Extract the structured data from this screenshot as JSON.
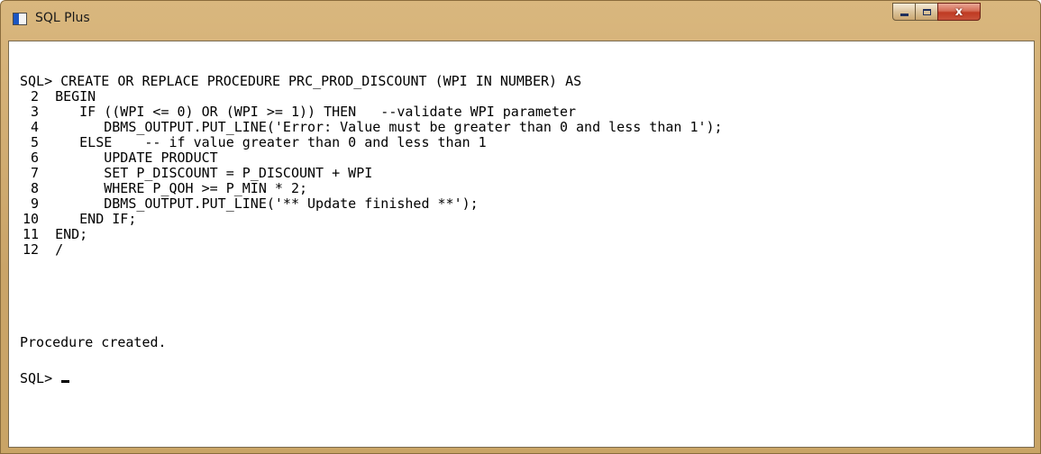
{
  "window": {
    "title": "SQL Plus",
    "title_icon": "sqlplus-console-icon",
    "controls": {
      "minimize_icon": "minimize-icon",
      "maximize_icon": "maximize-icon",
      "close_icon": "close-icon",
      "close_glyph": "x"
    }
  },
  "console": {
    "prompt": "SQL>",
    "first_line": "CREATE OR REPLACE PROCEDURE PRC_PROD_DISCOUNT (WPI IN NUMBER) AS",
    "code_lines": [
      {
        "num": "2",
        "text": "BEGIN"
      },
      {
        "num": "3",
        "text": "   IF ((WPI <= 0) OR (WPI >= 1)) THEN   --validate WPI parameter"
      },
      {
        "num": "4",
        "text": "      DBMS_OUTPUT.PUT_LINE('Error: Value must be greater than 0 and less than 1');"
      },
      {
        "num": "5",
        "text": "   ELSE    -- if value greater than 0 and less than 1"
      },
      {
        "num": "6",
        "text": "      UPDATE PRODUCT"
      },
      {
        "num": "7",
        "text": "      SET P_DISCOUNT = P_DISCOUNT + WPI"
      },
      {
        "num": "8",
        "text": "      WHERE P_QOH >= P_MIN * 2;"
      },
      {
        "num": "9",
        "text": "      DBMS_OUTPUT.PUT_LINE('** Update finished **');"
      },
      {
        "num": "10",
        "text": "   END IF;"
      },
      {
        "num": "11",
        "text": "END;"
      },
      {
        "num": "12",
        "text": "/"
      }
    ],
    "output": "Procedure created.",
    "final_prompt": "SQL>",
    "cursor_char": "_"
  },
  "colors": {
    "frame": "#c9a466",
    "console_bg": "#ffffff",
    "text": "#000000",
    "close_button": "#c7513a"
  }
}
